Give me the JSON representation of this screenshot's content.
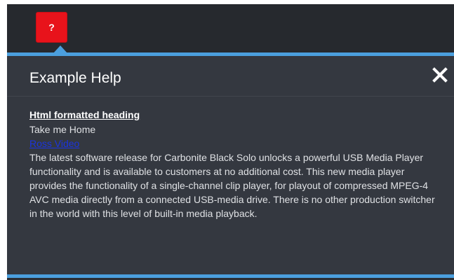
{
  "toolbar": {
    "help_button_label": "?",
    "help_button_color": "#e8131b"
  },
  "theme": {
    "accent": "#4b9fde",
    "panel_bg": "#343840",
    "link_color": "#1a34e0"
  },
  "help_panel": {
    "title": "Example Help",
    "close_icon": "close-icon",
    "heading": "Html formatted heading",
    "line": "Take me Home",
    "link_text": "Ross Video",
    "paragraph": "The latest software release for Carbonite Black Solo unlocks a powerful USB Media Player functionality and is available to customers at no additional cost. This new media player provides the functionality of a single-channel clip player, for playout of compressed MPEG-4 AVC media directly from a connected USB-media drive. There is no other production switcher in the world with this level of built-in media playback."
  }
}
